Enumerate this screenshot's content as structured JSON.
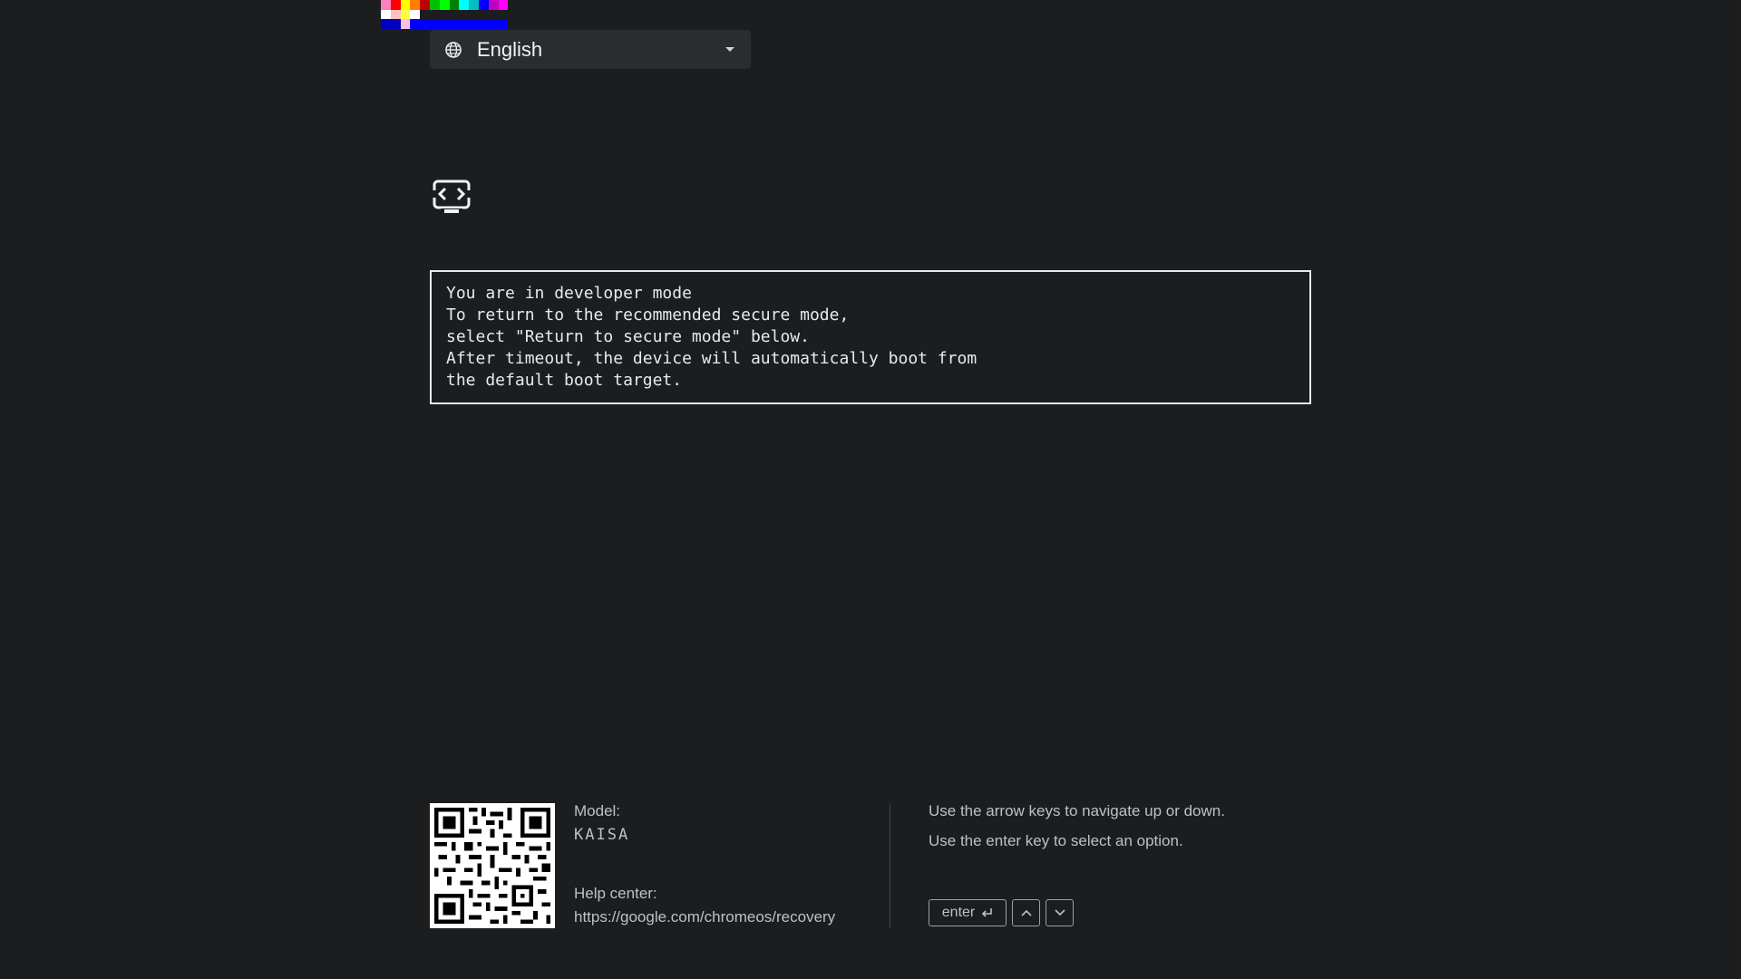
{
  "debug_strip": {
    "row1": [
      "#ff80c0",
      "#ff0000",
      "#ffff00",
      "#ff8000",
      "#c00000",
      "#00c000",
      "#00ff00",
      "#008000",
      "#00ffff",
      "#00c0c0",
      "#0000ff",
      "#c000c0",
      "#ff00ff"
    ],
    "row2": [
      "#ffffff",
      "#ffc0c0",
      "#ffff40",
      "#ffffff",
      "#1b1d1f",
      "#1b1d1f",
      "#1b1d1f",
      "#1b1d1f",
      "#1b1d1f",
      "#1b1d1f",
      "#1b1d1f",
      "#1b1d1f",
      "#1b1d1f"
    ],
    "row3": [
      "#0000c0",
      "#0000c0",
      "#ffc0e0",
      "#0000ff",
      "#0000ff",
      "#0000ff",
      "#0000ff",
      "#0000ff",
      "#0000ff",
      "#0000ff",
      "#0000ff",
      "#0000ff",
      "#0000ff"
    ]
  },
  "language_select": {
    "icon": "globe-icon",
    "label": "English",
    "caret_icon": "caret-down-icon"
  },
  "dev_mode_icon": "developer-mode-icon",
  "message": {
    "lines": [
      "You are in developer mode",
      "To return to the recommended secure mode,",
      "select \"Return to secure mode\" below.",
      "After timeout, the device will automatically boot from",
      "the default boot target."
    ]
  },
  "footer": {
    "qr_icon": "qr-code-icon",
    "model_label": "Model:",
    "model_value": "KAISA",
    "help_label": "Help center:",
    "help_url": "https://google.com/chromeos/recovery",
    "instruction_navigate": "Use the arrow keys to navigate up or down.",
    "instruction_select": "Use the enter key to select an option.",
    "key_enter_label": "enter",
    "key_enter_icon": "return-arrow-icon",
    "key_up_icon": "chevron-up-icon",
    "key_down_icon": "chevron-down-icon"
  },
  "colors": {
    "background": "#1b1d1f",
    "select_background": "#2a2c2f",
    "text_primary": "#e8eaed",
    "text_secondary": "#bdc1c6"
  }
}
